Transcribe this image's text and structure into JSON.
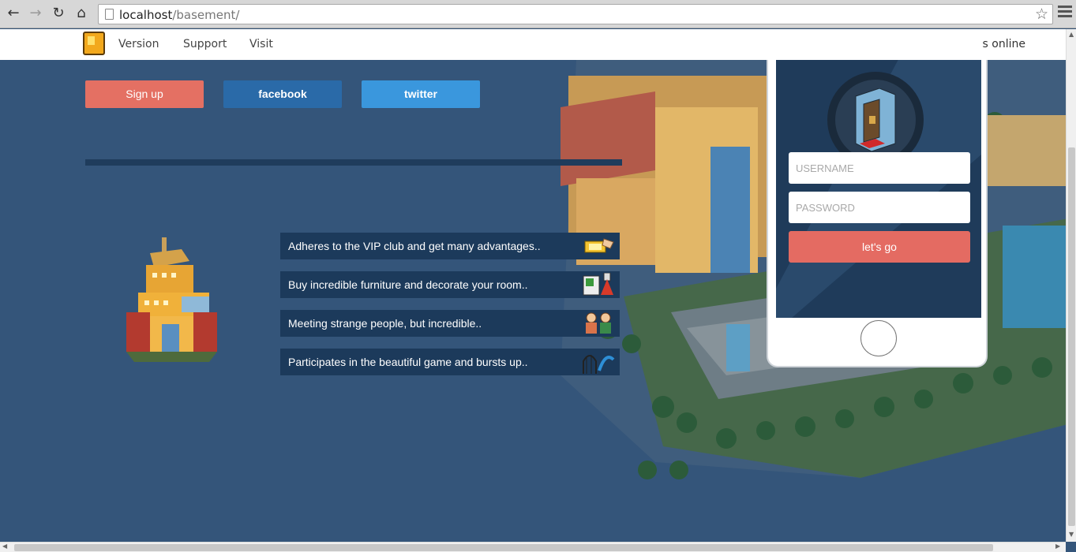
{
  "browser": {
    "url_host": "localhost",
    "url_path": "/basement/"
  },
  "header": {
    "nav": [
      "Version",
      "Support",
      "Visit"
    ],
    "online_text": "s online"
  },
  "hero": {
    "signup_label": "Sign up",
    "facebook_label": "facebook",
    "twitter_label": "twitter"
  },
  "features": [
    {
      "text": "Adheres to the VIP club and get many advantages..",
      "icon": "vip-ticket-icon"
    },
    {
      "text": "Buy incredible furniture and decorate your room..",
      "icon": "furniture-catalog-icon"
    },
    {
      "text": "Meeting strange people, but incredible..",
      "icon": "people-icon"
    },
    {
      "text": "Participates in the beautiful game and bursts up..",
      "icon": "rollercoaster-icon"
    }
  ],
  "login": {
    "username_placeholder": "USERNAME",
    "password_placeholder": "PASSWORD",
    "submit_label": "let's go"
  },
  "colors": {
    "background": "#34557a",
    "signup": "#e47063",
    "facebook": "#2a6aa8",
    "twitter": "#3a97dd",
    "feature_bar": "#1c3a5b",
    "submit": "#e46b62"
  }
}
